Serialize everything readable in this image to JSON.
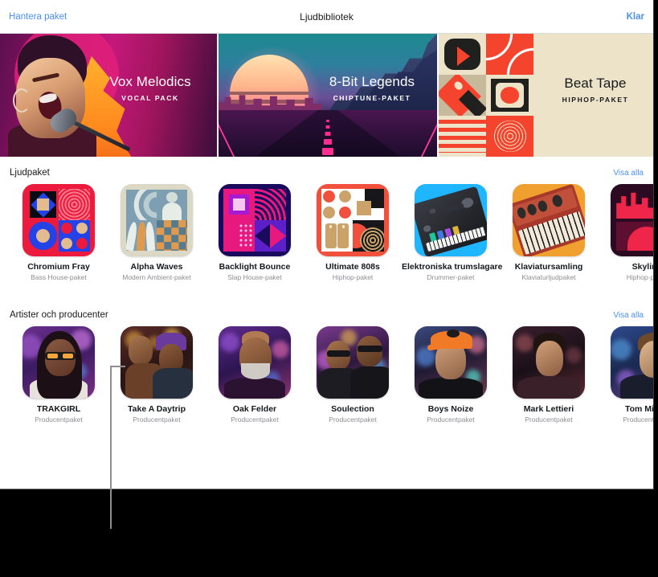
{
  "navbar": {
    "left_label": "Hantera paket",
    "title": "Ljudbibliotek",
    "right_label": "Klar"
  },
  "heroes": [
    {
      "title": "Vox Melodics",
      "subtitle": "VOCAL PACK",
      "theme": "light"
    },
    {
      "title": "8-Bit Legends",
      "subtitle": "CHIPTUNE-PAKET",
      "theme": "light"
    },
    {
      "title": "Beat Tape",
      "subtitle": "HIPHOP-PAKET",
      "theme": "dark"
    }
  ],
  "sections": [
    {
      "title": "Ljudpaket",
      "see_all": "Visa alla",
      "items": [
        {
          "name": "Chromium Fray",
          "sub": "Bass House-paket"
        },
        {
          "name": "Alpha Waves",
          "sub": "Modern Ambient-paket"
        },
        {
          "name": "Backlight Bounce",
          "sub": "Slap House-paket"
        },
        {
          "name": "Ultimate 808s",
          "sub": "Hiphop-paket"
        },
        {
          "name": "Elektroniska trumslagare",
          "sub": "Drummer-paket"
        },
        {
          "name": "Klaviatursamling",
          "sub": "Klaviaturljudpaket"
        },
        {
          "name": "Skyline",
          "sub": "Hiphop-paket"
        }
      ]
    },
    {
      "title": "Artister och producenter",
      "see_all": "Visa alla",
      "items": [
        {
          "name": "TRAKGIRL",
          "sub": "Producentpaket"
        },
        {
          "name": "Take A Daytrip",
          "sub": "Producentpaket"
        },
        {
          "name": "Oak Felder",
          "sub": "Producentpaket"
        },
        {
          "name": "Soulection",
          "sub": "Producentpaket"
        },
        {
          "name": "Boys Noize",
          "sub": "Producentpaket"
        },
        {
          "name": "Mark Lettieri",
          "sub": "Producentpaket"
        },
        {
          "name": "Tom Misch",
          "sub": "Producentpaket"
        }
      ]
    }
  ],
  "colors": {
    "accent_link": "#4a90f0",
    "text_primary": "#15181c",
    "text_secondary": "#8e8e93",
    "panel_bg": "#ffffff",
    "backdrop": "#000000",
    "leader_line": "#8e8e93"
  }
}
